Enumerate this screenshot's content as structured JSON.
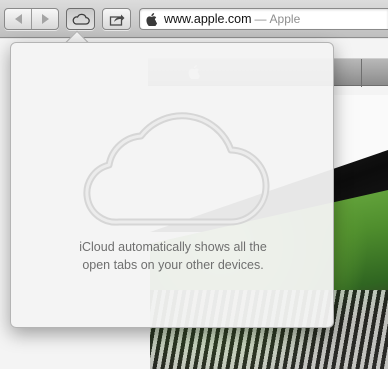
{
  "toolbar": {
    "back_icon": "back-arrow-icon",
    "forward_icon": "forward-arrow-icon",
    "icloud_tabs_icon": "cloud-icon",
    "share_icon": "share-arrow-icon"
  },
  "address_bar": {
    "site_icon": "apple-logo-icon",
    "url": "www.apple.com",
    "separator": "—",
    "page_title": "Apple"
  },
  "icloud_popover": {
    "icon": "cloud-icon",
    "message_line1": "iCloud automatically shows all the",
    "message_line2": "open tabs on your other devices."
  },
  "page": {
    "nav_icon": "apple-logo-icon"
  },
  "colors": {
    "popover_bg": "#f3f3f3",
    "message_text": "#6f6f6f",
    "url_text": "#111111",
    "title_text": "#8e8e8e"
  }
}
